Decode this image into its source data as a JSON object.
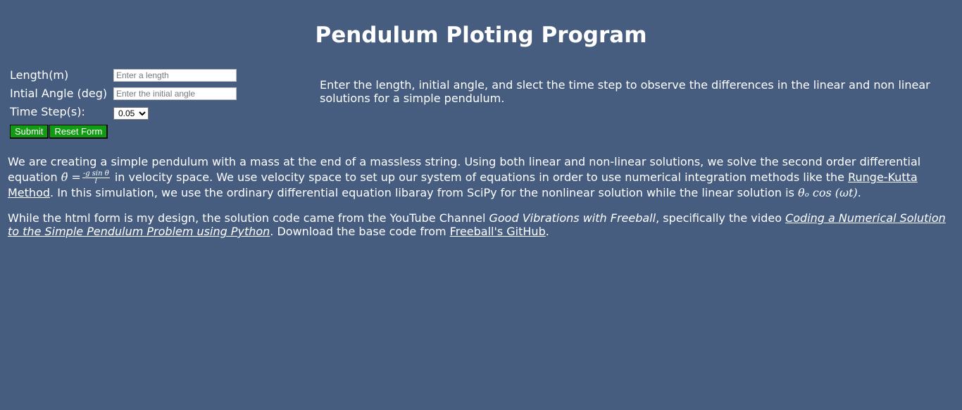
{
  "header": {
    "title": "Pendulum Ploting Program"
  },
  "form": {
    "length_label": "Length(m)",
    "length_placeholder": "Enter a length",
    "angle_label": "Intial Angle (deg)",
    "angle_placeholder": "Enter the initial angle",
    "timestep_label": "Time Step(s):",
    "timestep_selected": "0.05",
    "submit_label": "Submit",
    "reset_label": "Reset Form"
  },
  "intro": "Enter the length, initial angle, and slect the time step to observe the differences in the linear and non linear solutions for a simple pendulum.",
  "description": {
    "p1_a": "We are creating a simple pendulum with a mass at the end of a massless string. Using both linear and non-linear solutions, we solve the second order differential equation",
    "eq_lhs": "θ̈ =",
    "eq_num": "-g sin θ",
    "eq_den": "l",
    "p1_b": "in velocity space. We use velocity space to set up our system of equations in order to use numerical integration methods like the",
    "runge_link": "Runge-Kutta Method",
    "p1_c": ". In this simulation, we use the ordinary differential equation libaray from SciPy for the nonlinear solution while the linear solution is",
    "linear_eq": "θₒ cos (ωt)",
    "p1_d": ".",
    "p2_a": "While the html form is my design, the solution code came from the YouTube Channel",
    "channel_name": "Good Vibrations with Freeball",
    "p2_b": ", specifically the video",
    "video_link": "Coding a Numerical Solution to the Simple Pendulum Problem using Python",
    "p2_c": ". Download the base code from",
    "github_link": "Freeball's GitHub",
    "p2_d": "."
  }
}
